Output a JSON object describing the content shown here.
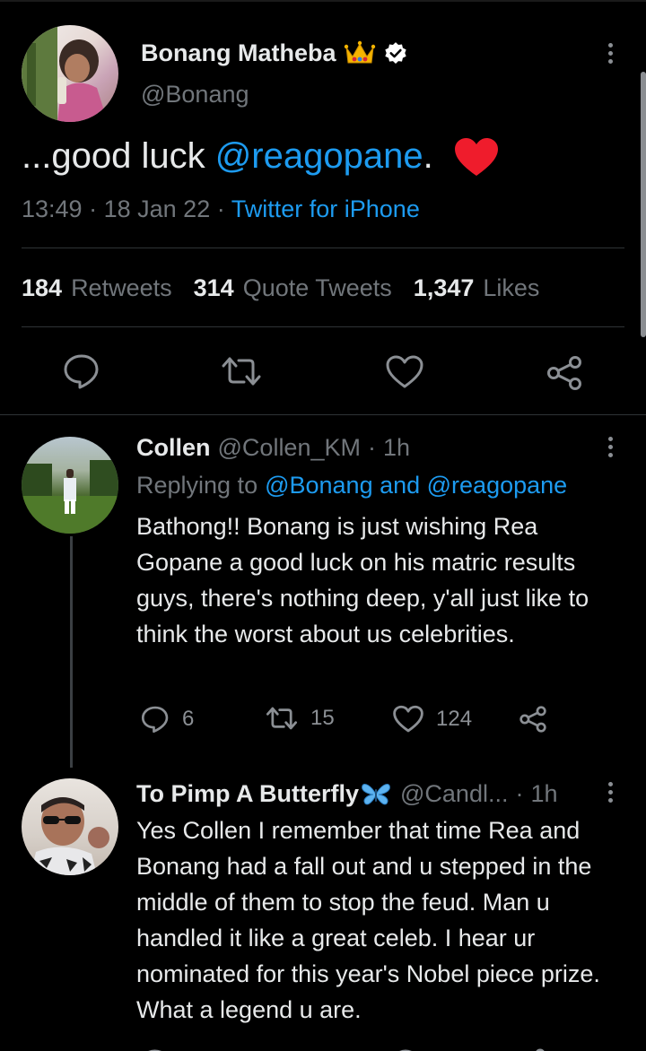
{
  "colors": {
    "background": "#000000",
    "text": "#e7e9ea",
    "muted": "#71767b",
    "link": "#1d9bf0",
    "heart": "#f4212e"
  },
  "main_tweet": {
    "author_name": "Bonang Matheba",
    "badges": [
      "crown-emoji",
      "verified-badge"
    ],
    "handle": "@Bonang",
    "text_prefix": "...good luck ",
    "mention": "@reagopane",
    "text_suffix": ".",
    "emoji": "heart-emoji",
    "time": "13:49",
    "date": "18 Jan 22",
    "separator": "·",
    "source": "Twitter for iPhone",
    "stats": {
      "retweets_count": "184",
      "retweets_label": "Retweets",
      "quotes_count": "314",
      "quotes_label": "Quote Tweets",
      "likes_count": "1,347",
      "likes_label": "Likes"
    },
    "actions": [
      "reply-icon",
      "retweet-icon",
      "like-icon",
      "share-icon"
    ]
  },
  "replies": [
    {
      "author_name": "Collen",
      "handle": "@Collen_KM",
      "time_sep": "·",
      "time": "1h",
      "replying_label": "Replying to",
      "replying_to": "@Bonang and @reagopane",
      "text": "Bathong!! Bonang is just wishing Rea Gopane a good luck on his matric results guys, there's nothing deep, y'all just like to think the worst about us celebrities.",
      "reply_count": "6",
      "retweet_count": "15",
      "like_count": "124"
    },
    {
      "author_name": "To Pimp A Butterfly",
      "name_emoji": "butterfly-emoji",
      "handle": "@Candl...",
      "time_sep": "·",
      "time": "1h",
      "text": "Yes Collen I remember that time Rea and Bonang had a fall out and u stepped in the middle of them to stop the feud. Man u handled it like a great celeb. I hear ur nominated for this year's Nobel piece prize. What a legend u are."
    }
  ]
}
